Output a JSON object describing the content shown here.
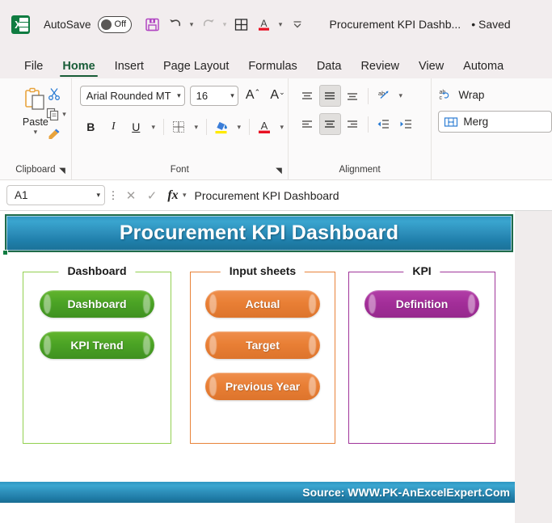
{
  "quick_access": {
    "app_icon": "excel-logo-icon",
    "autosave_label": "AutoSave",
    "autosave_state": "Off",
    "buttons": [
      {
        "icon": "save-icon"
      },
      {
        "icon": "undo-icon"
      },
      {
        "icon": "redo-icon"
      },
      {
        "icon": "table-borders-icon"
      },
      {
        "icon": "font-color-icon"
      },
      {
        "icon": "customize-quick-access-toolbar-icon"
      }
    ],
    "document_title": "Procurement KPI Dashb...",
    "save_state": "• Saved"
  },
  "ribbon_tabs": [
    {
      "label": "File",
      "active": false
    },
    {
      "label": "Home",
      "active": true
    },
    {
      "label": "Insert",
      "active": false
    },
    {
      "label": "Page Layout",
      "active": false
    },
    {
      "label": "Formulas",
      "active": false
    },
    {
      "label": "Data",
      "active": false
    },
    {
      "label": "Review",
      "active": false
    },
    {
      "label": "View",
      "active": false
    },
    {
      "label": "Automa",
      "active": false
    }
  ],
  "ribbon": {
    "clipboard": {
      "group_label": "Clipboard",
      "paste_label": "Paste",
      "cut_icon": "scissors-icon",
      "copy_icon": "copy-icon",
      "format_painter_icon": "format-painter-icon"
    },
    "font": {
      "group_label": "Font",
      "font_name": "Arial Rounded MT",
      "font_size": "16",
      "grow_font": "A",
      "shrink_font": "A",
      "bold": "B",
      "italic": "I",
      "underline": "U",
      "borders_icon": "borders-icon",
      "fill_color_icon": "fill-color-icon",
      "font_color_icon": "font-color-icon"
    },
    "alignment": {
      "group_label": "Alignment",
      "orientation_icon": "text-orientation-icon",
      "decrease_indent_icon": "decrease-indent-icon",
      "increase_indent_icon": "increase-indent-icon",
      "wrap_text_label": "Wrap",
      "merge_label": "Merg"
    }
  },
  "formula_bar": {
    "name_box": "A1",
    "cancel_icon": "cancel-icon",
    "enter_icon": "enter-icon",
    "fx_icon": "insert-function-icon",
    "formula_value": "Procurement KPI Dashboard"
  },
  "dashboard": {
    "title": "Procurement KPI Dashboard",
    "source_text": "Source: WWW.PK-AnExcelExpert.Com",
    "colors": {
      "banner_blue": "#2b8cb8",
      "green": "#4ba325",
      "orange": "#e97f35",
      "purple": "#a32e99",
      "panel_green_border": "#92d050",
      "panel_orange_border": "#e8833a",
      "panel_purple_border": "#a0359a"
    },
    "panels": [
      {
        "label": "Dashboard",
        "color": "green",
        "buttons": [
          {
            "label": "Dashboard"
          },
          {
            "label": "KPI Trend"
          }
        ]
      },
      {
        "label": "Input sheets",
        "color": "orange",
        "buttons": [
          {
            "label": "Actual"
          },
          {
            "label": "Target"
          },
          {
            "label": "Previous Year"
          }
        ]
      },
      {
        "label": "KPI",
        "color": "purple",
        "buttons": [
          {
            "label": "Definition"
          }
        ]
      }
    ]
  }
}
